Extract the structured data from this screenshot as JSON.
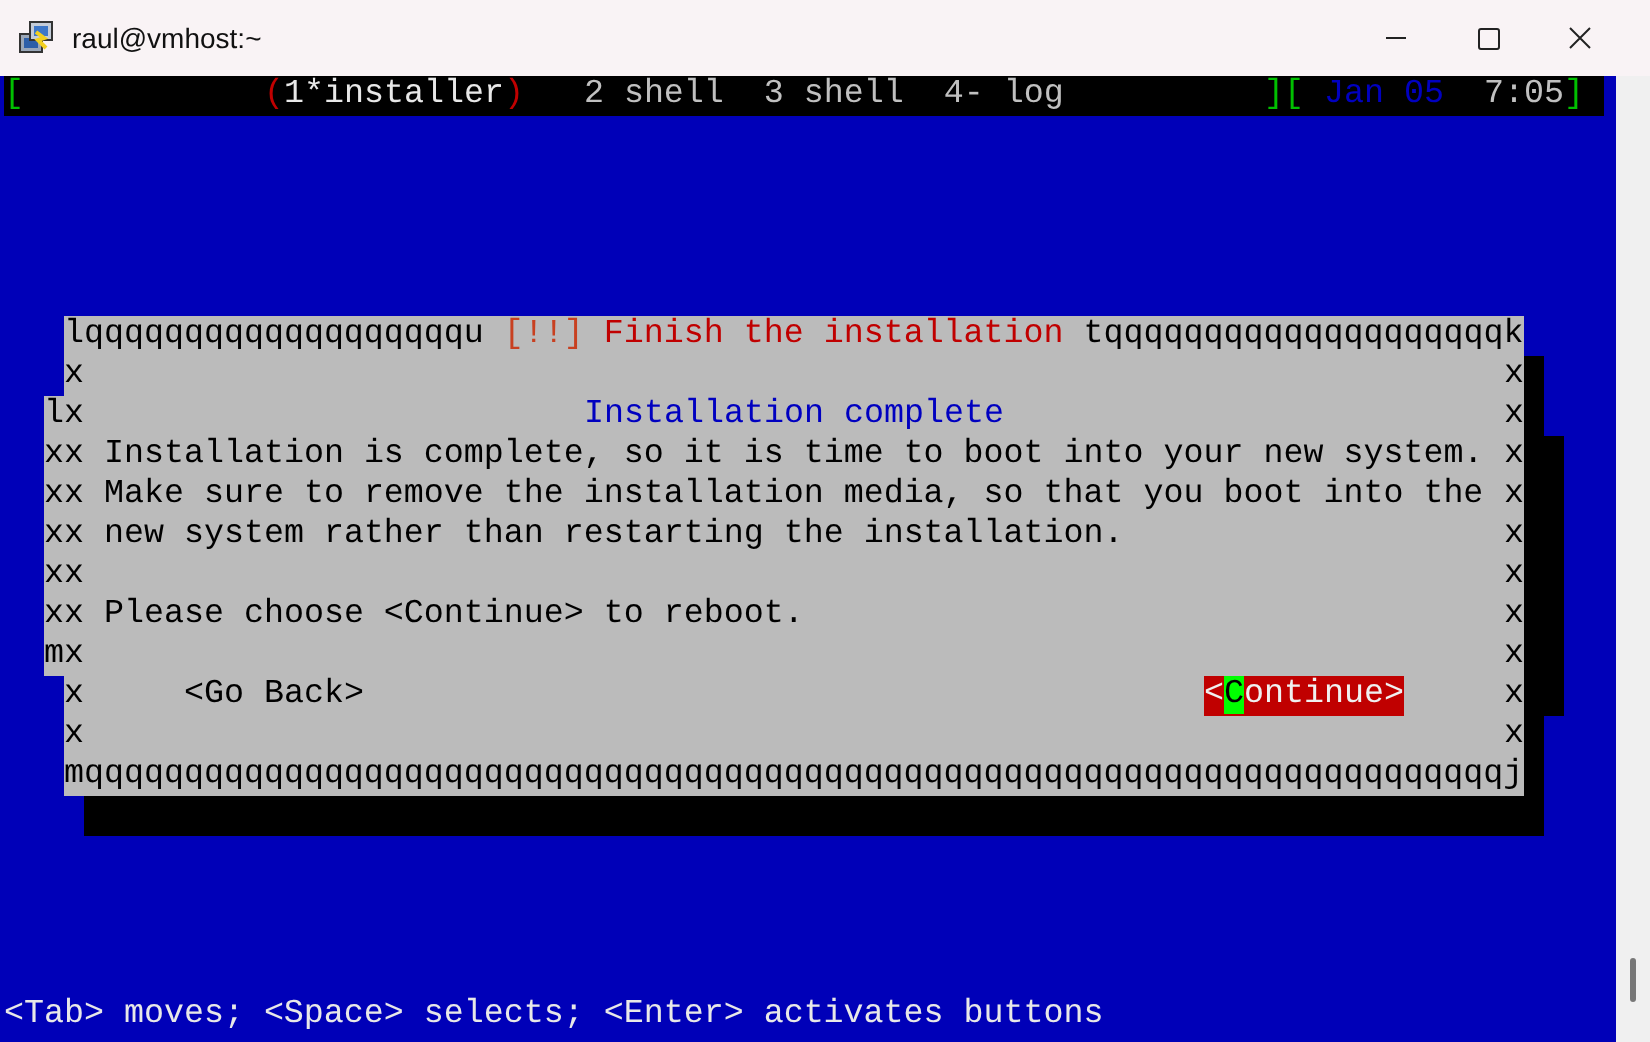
{
  "window": {
    "title": "raul@vmhost:~"
  },
  "status_bar": {
    "open_bracket": "[",
    "selection_marks": [
      "(",
      ")"
    ],
    "windows": [
      {
        "label": "1*installer",
        "selected": true
      },
      {
        "label": "2 shell",
        "selected": false
      },
      {
        "label": "3 shell",
        "selected": false
      },
      {
        "label": "4- log",
        "selected": false
      }
    ],
    "close_bracket": "]",
    "clock": {
      "open_bracket": "[",
      "date": "Jan 05",
      "time": "7:05",
      "close_bracket": "]"
    }
  },
  "background_dialog": {
    "left_border": [
      "l",
      "x",
      "x",
      "x",
      "x",
      "x",
      "m"
    ]
  },
  "dialog": {
    "top_border_left": "lqqqqqqqqqqqqqqqqqqqu",
    "title_mark": "[!!]",
    "title": "Finish the installation",
    "top_border_right": "tqqqqqqqqqqqqqqqqqqqqk",
    "rows": [
      {
        "kind": "blank",
        "left": "x",
        "right": "x"
      },
      {
        "kind": "heading",
        "left": "x",
        "right": "x",
        "text": "Installation complete"
      },
      {
        "kind": "text",
        "left": "x",
        "right": "x",
        "text": "Installation is complete, so it is time to boot into your new system."
      },
      {
        "kind": "text",
        "left": "x",
        "right": "x",
        "text": "Make sure to remove the installation media, so that you boot into the"
      },
      {
        "kind": "text",
        "left": "x",
        "right": "x",
        "text": "new system rather than restarting the installation."
      },
      {
        "kind": "blank",
        "left": "x",
        "right": "x"
      },
      {
        "kind": "text",
        "left": "x",
        "right": "x",
        "text": "Please choose <Continue> to reboot."
      },
      {
        "kind": "blank",
        "left": "x",
        "right": "x"
      },
      {
        "kind": "buttons",
        "left": "x",
        "right": "x",
        "buttons": [
          {
            "label": "<Go Back>",
            "selected": false
          },
          {
            "label": "<Continue>",
            "selected": true
          }
        ]
      },
      {
        "kind": "blank",
        "left": "x",
        "right": "x"
      }
    ],
    "bottom_border": "mqqqqqqqqqqqqqqqqqqqqqqqqqqqqqqqqqqqqqqqqqqqqqqqqqqqqqqqqqqqqqqqqqqqqqqqj"
  },
  "help_line": "<Tab> moves; <Space> selects; <Enter> activates buttons"
}
